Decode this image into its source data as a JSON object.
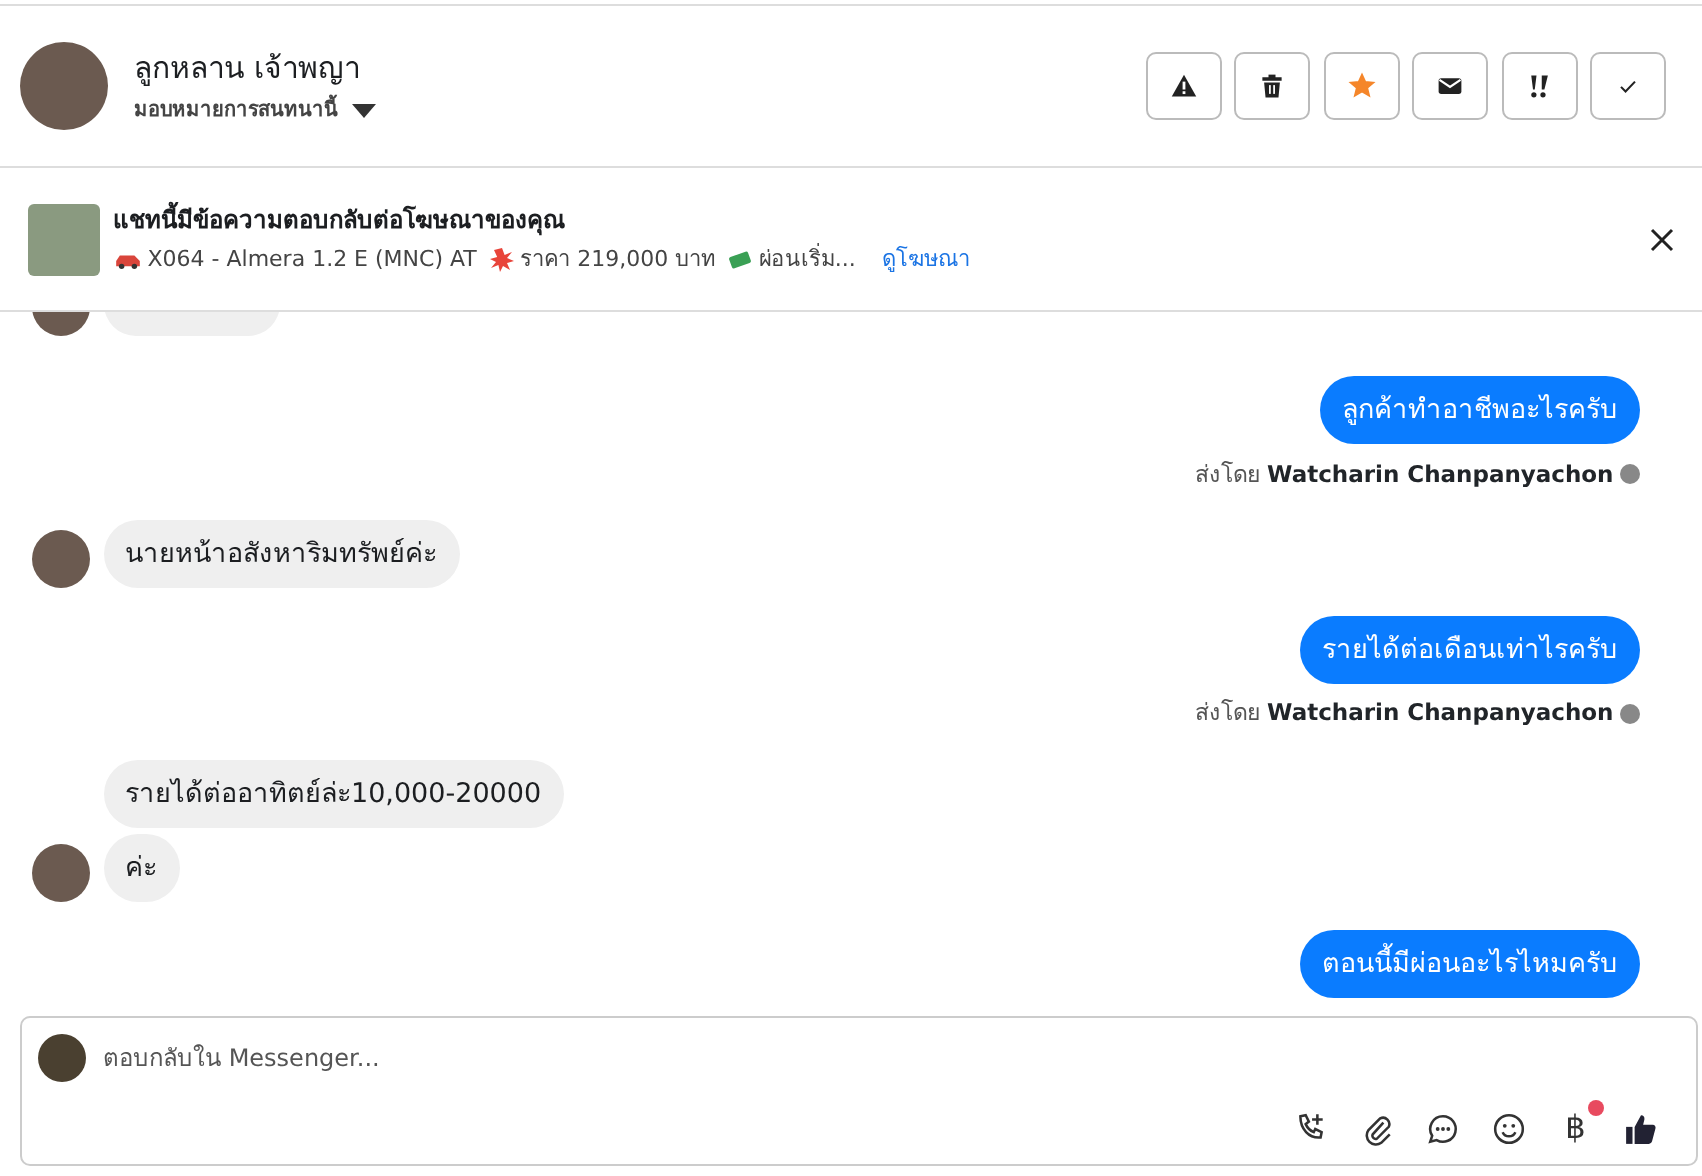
{
  "header": {
    "name": "ลูกหลาน เจ้าพญา",
    "assign": "มอบหมายการสนทนานี้",
    "actions": [
      {
        "kind": "warning"
      },
      {
        "kind": "trash"
      },
      {
        "kind": "star",
        "on": true
      },
      {
        "kind": "mail"
      },
      {
        "kind": "urgent"
      },
      {
        "kind": "check"
      }
    ]
  },
  "ad_banner": {
    "title": "แชทนี้มีข้อความตอบกลับต่อโฆษณาของคุณ",
    "segments": [
      "X064 - Almera 1.2 E (MNC) AT",
      "ราคา 219,000 บาท",
      "ผ่อนเริ่ม..."
    ],
    "link": "ดูโฆษณา"
  },
  "messages": [
    {
      "kind": "partial",
      "avatar": true
    },
    {
      "kind": "outgoing",
      "text": "ลูกค้าทำอาชีพอะไรครับ",
      "sent_by_label": "ส่งโดย",
      "sender": "Watcharin Chanpanyachon"
    },
    {
      "kind": "incoming",
      "text": "นายหน้าอสังหาริมทรัพย์ค่ะ",
      "avatar": true
    },
    {
      "kind": "outgoing",
      "text": "รายได้ต่อเดือนเท่าไรครับ",
      "sent_by_label": "ส่งโดย",
      "sender": "Watcharin Chanpanyachon"
    },
    {
      "kind": "incoming",
      "text": "รายได้ต่ออาทิตย์ล่ะ10,000-20000",
      "avatar": false
    },
    {
      "kind": "incoming",
      "text": "ค่ะ",
      "avatar": true
    },
    {
      "kind": "outgoing",
      "text": "ตอนนี้มีผ่อนอะไรไหมครับ"
    }
  ],
  "composer": {
    "placeholder": "ตอบกลับใน Messenger...",
    "currency_symbol": "฿",
    "currency_badge": true
  }
}
